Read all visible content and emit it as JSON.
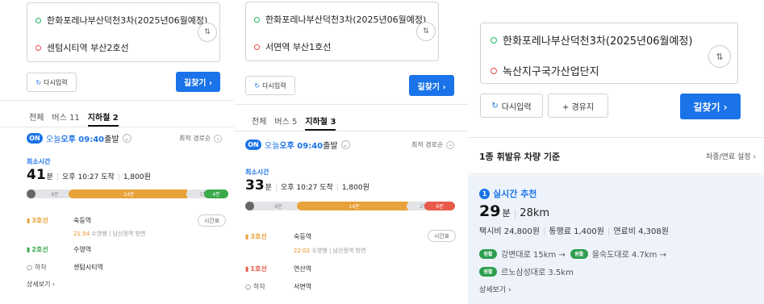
{
  "panel1": {
    "origin": "한화포레나부산덕천3차(2025년06월예정)",
    "destination": "센텀시티역 부산2호선",
    "reset_label": "다시입력",
    "search_label": "길찾기 ›",
    "tabs": [
      {
        "label": "전체"
      },
      {
        "label": "버스 11"
      },
      {
        "label": "지하철 2"
      }
    ],
    "depart_on": "ON",
    "depart_prefix": "오늘 ",
    "depart_time": "오후 09:40",
    "depart_suffix": " 출발",
    "sort": "최적 경로순",
    "min_time_label": "최소시간",
    "duration_num": "41",
    "duration_unit": "분",
    "arrival": "오후 10:27 도착",
    "fare": "1,800원",
    "bar": {
      "walk1": "8분",
      "ride": "24분",
      "walk2": "1분",
      "last": "4분"
    },
    "stops": {
      "line1": "3호선",
      "station1": "숙등역",
      "timetable": "시간표",
      "note_time": "21:54",
      "note_text": " 수영행 | 남산정역 방면",
      "line2": "2호선",
      "station2": "수영역",
      "alight": "하차",
      "station3": "센텀시티역"
    },
    "more": "상세보기 ›"
  },
  "panel2": {
    "origin": "한화포레나부산덕천3차(2025년06월예정)",
    "destination": "서면역 부산1호선",
    "reset_label": "다시입력",
    "search_label": "길찾기 ›",
    "tabs": [
      {
        "label": "전체"
      },
      {
        "label": "버스 5"
      },
      {
        "label": "지하철 3"
      }
    ],
    "depart_on": "ON",
    "depart_prefix": "오늘 ",
    "depart_time": "오후 09:40",
    "depart_suffix": " 출발",
    "sort": "최적 경로순",
    "min_time_label": "최소시간",
    "duration_num": "33",
    "duration_unit": "분",
    "arrival": "오후 10:27 도착",
    "fare": "1,800원",
    "bar": {
      "walk1": "8분",
      "ride": "14분",
      "walk2": "2분",
      "last": "6분"
    },
    "stops": {
      "line1": "3호선",
      "station1": "숙등역",
      "timetable": "시간표",
      "note_time": "22:02",
      "note_text": " 수영행 | 남산정역 방면",
      "line2": "1호선",
      "station2": "연산역",
      "alight": "하차",
      "station3": "서면역"
    }
  },
  "panel3": {
    "origin": "한화포레나부산덕천3차(2025년06월예정)",
    "destination": "녹산지구국가산업단지",
    "reset_label": "다시입력",
    "waypoint_label": "+ 경유지",
    "search_label": "길찾기 ›",
    "vehicle": "1종 휘발유 차량 기준",
    "settings": "차종/연료 설정 ›",
    "realtime": "실시간 추천",
    "realtime_num": "1",
    "duration_num": "29",
    "duration_unit": "분",
    "distance": "28km",
    "taxi": "택시비 24,800원",
    "toll": "통행료 1,400원",
    "fuel": "연료비 4,308원",
    "road_badge": "원활",
    "road1": "강변대로 15km →",
    "road2": "을숙도대로 4.7km →",
    "road3": "르노삼성대로 3.5km",
    "more": "상세보기 ›"
  },
  "colors": {
    "accent": "#1a73e8",
    "line3": "#e8a23a",
    "line2": "#3aaa4a",
    "line1": "#e85a4a",
    "road_good": "#2e9e4f"
  }
}
